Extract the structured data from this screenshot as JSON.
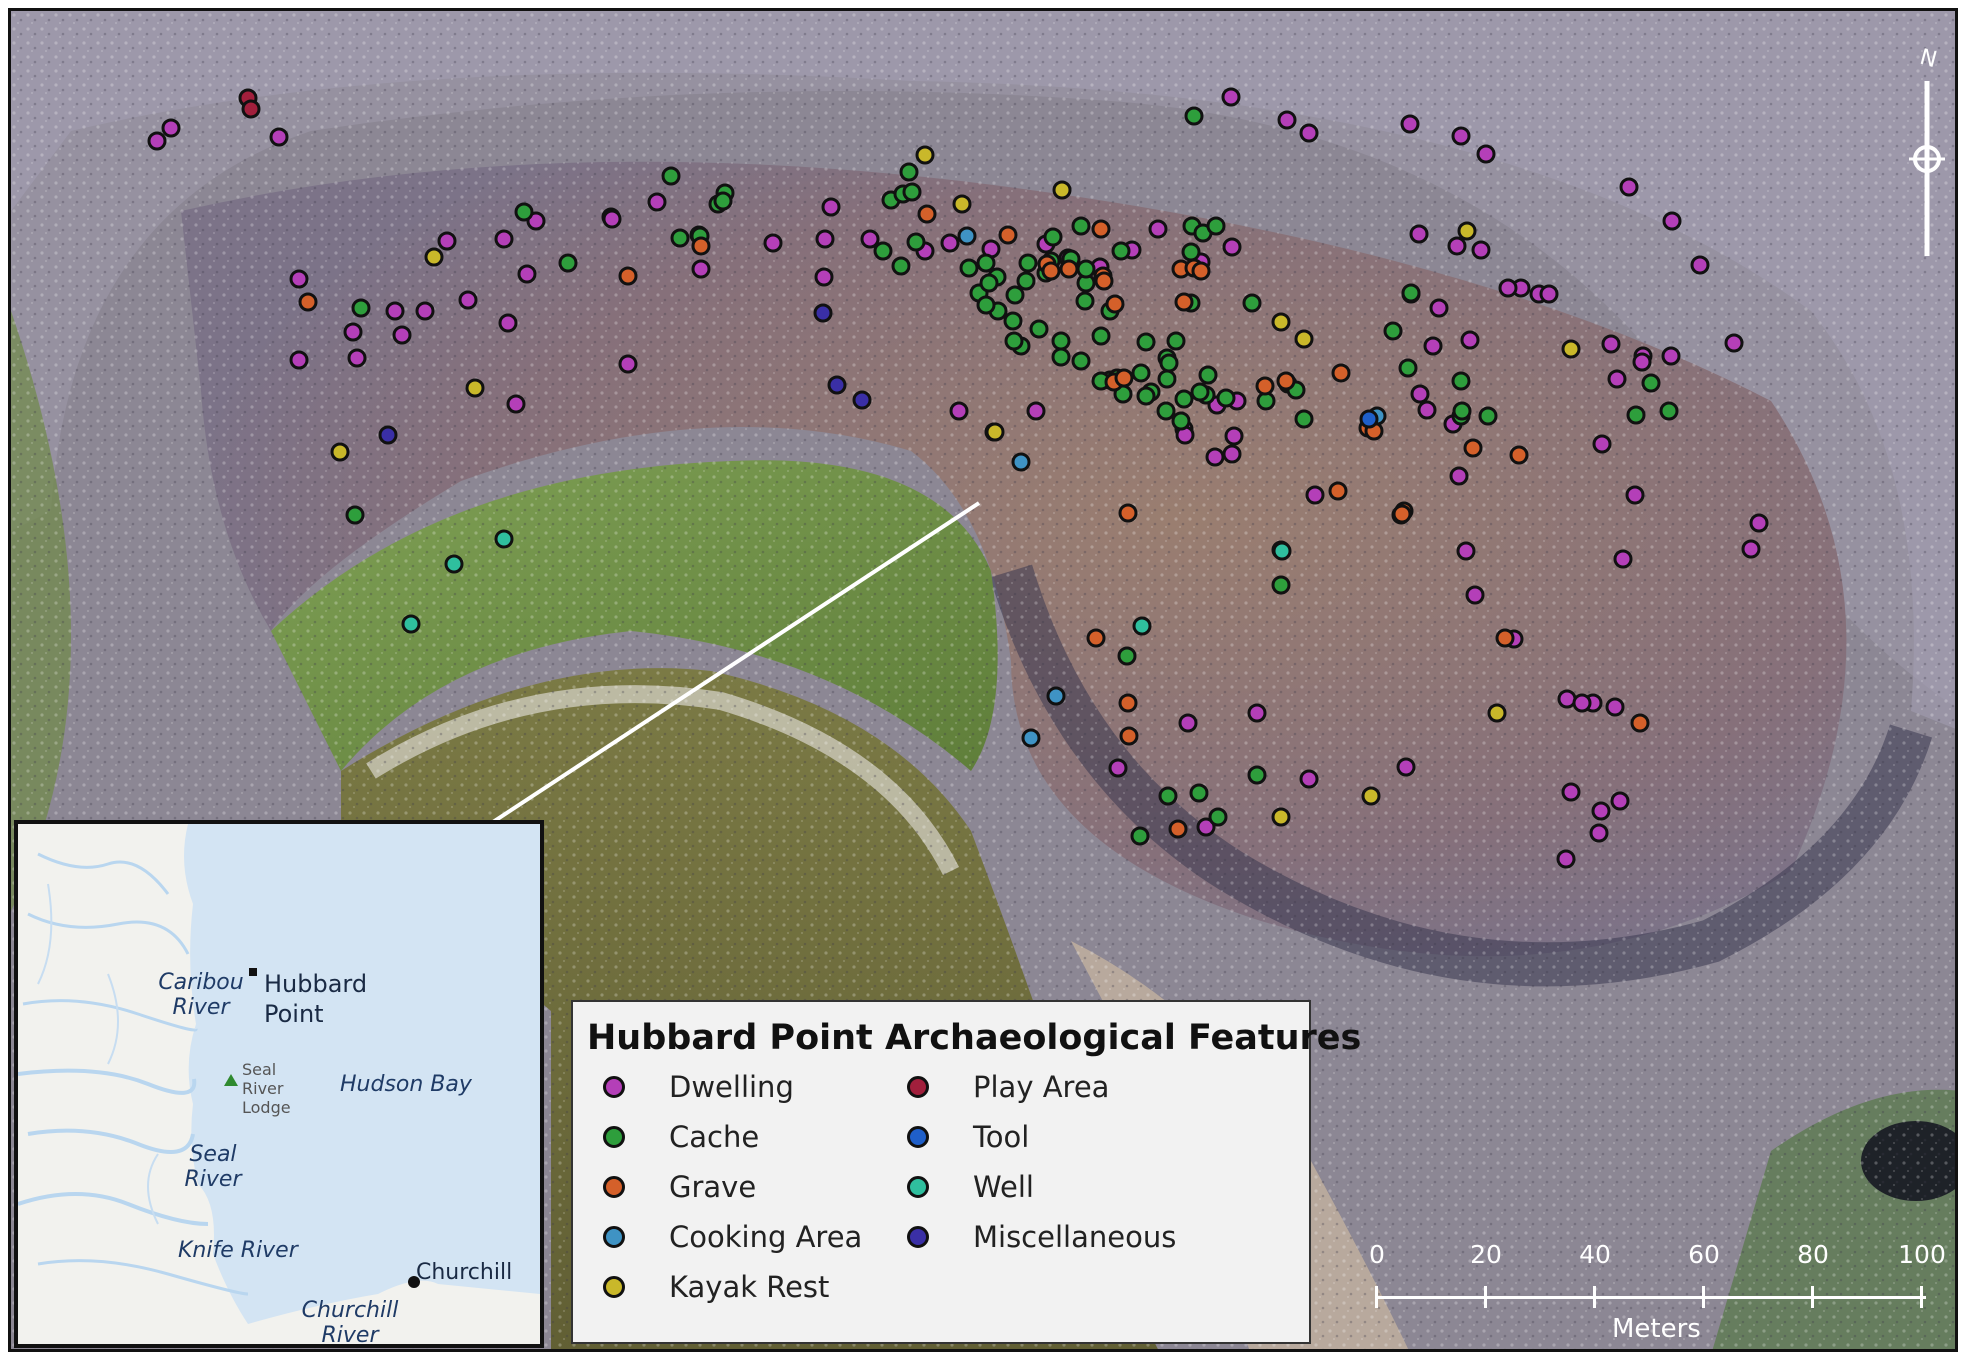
{
  "title": "Hubbard Point Archaeological Features",
  "legend": [
    {
      "key": "dwelling",
      "label": "Dwelling",
      "color": "#b43fb8"
    },
    {
      "key": "cache",
      "label": "Cache",
      "color": "#2e9e3c"
    },
    {
      "key": "grave",
      "label": "Grave",
      "color": "#d4602a"
    },
    {
      "key": "cooking",
      "label": "Cooking Area",
      "color": "#3f93c4"
    },
    {
      "key": "kayak",
      "label": "Kayak Rest",
      "color": "#c9b82a"
    },
    {
      "key": "play",
      "label": "Play Area",
      "color": "#a11f3c"
    },
    {
      "key": "tool",
      "label": "Tool",
      "color": "#1f5fc9"
    },
    {
      "key": "well",
      "label": "Well",
      "color": "#2fbf9e"
    },
    {
      "key": "misc",
      "label": "Miscellaneous",
      "color": "#3a2fa6"
    }
  ],
  "inset": {
    "hubbard_point": "Hubbard\nPoint",
    "caribou_river": "Caribou\nRiver",
    "seal_river_lodge": "Seal\nRiver\nLodge",
    "hudson_bay": "Hudson Bay",
    "seal_river": "Seal\nRiver",
    "knife_river": "Knife River",
    "churchill": "Churchill",
    "churchill_river": "Churchill\nRiver"
  },
  "scale": {
    "ticks": [
      "0",
      "20",
      "40",
      "60",
      "80",
      "100"
    ],
    "unit": "Meters"
  },
  "north_arrow": {
    "symbol": "N"
  }
}
